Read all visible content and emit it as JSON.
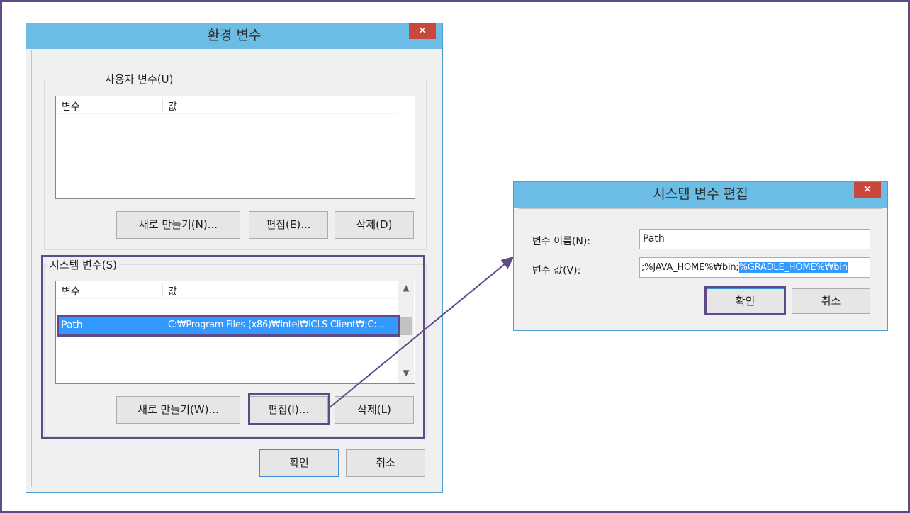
{
  "env_dialog": {
    "title": "환경 변수",
    "close_glyph": "✕",
    "user_vars": {
      "legend": "사용자 변수(U)",
      "col_variable": "변수",
      "col_value": "값",
      "new_button": "새로 만들기(N)...",
      "edit_button": "편집(E)...",
      "delete_button": "삭제(D)"
    },
    "system_vars": {
      "legend": "시스템 변수(S)",
      "col_variable": "변수",
      "col_value": "값",
      "rows": [
        {
          "name": "Path",
          "value": "C:₩Program Files (x86)₩Intel₩iCLS Client₩;C:..."
        }
      ],
      "new_button": "새로 만들기(W)...",
      "edit_button": "편집(I)...",
      "delete_button": "삭제(L)"
    },
    "ok_button": "확인",
    "cancel_button": "취소"
  },
  "edit_dialog": {
    "title": "시스템 변수 편집",
    "close_glyph": "✕",
    "name_label": "변수 이름(N):",
    "name_value": "Path",
    "value_label": "변수 값(V):",
    "value_unselected": ";%JAVA_HOME%₩bin;",
    "value_selected": "%GRADLE_HOME%₩bin",
    "ok_button": "확인",
    "cancel_button": "취소"
  },
  "colors": {
    "frame": "#5e4a87",
    "titlebar": "#6cbde6",
    "close": "#c9483b",
    "selection": "#3399ff",
    "highlight_border": "#5e4a87"
  }
}
